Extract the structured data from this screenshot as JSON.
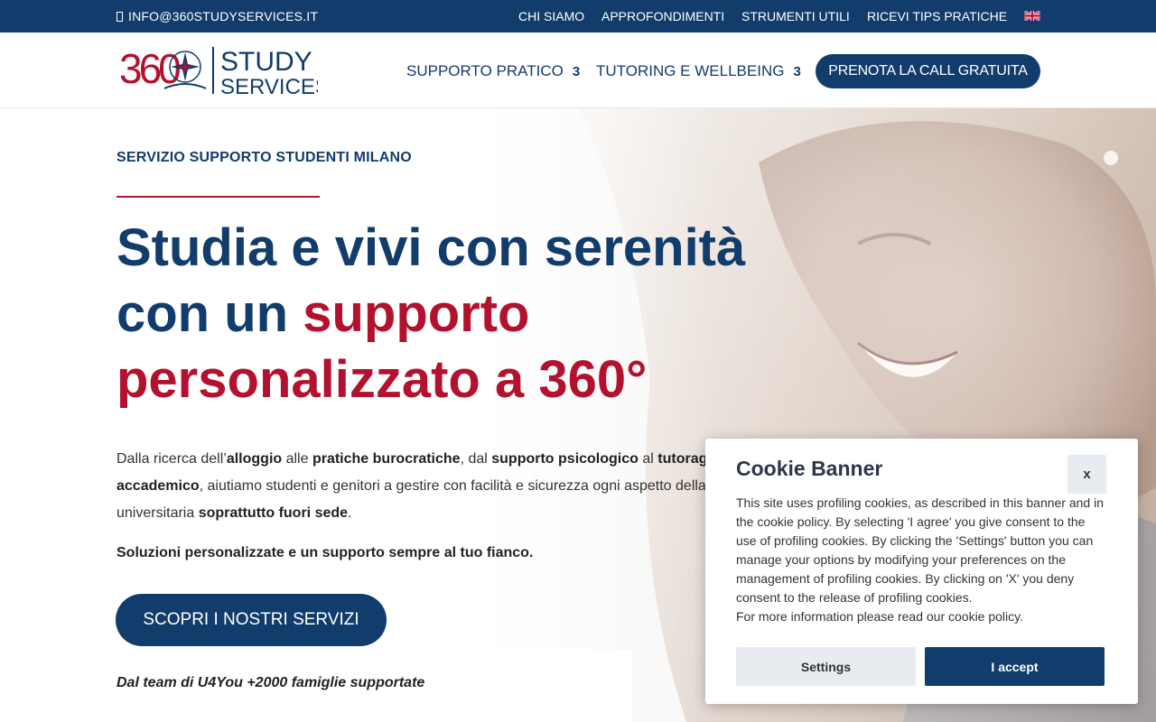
{
  "topbar": {
    "email": "INFO@360STUDYSERVICES.IT",
    "links": [
      "CHI SIAMO",
      "APPROFONDIMENTI",
      "STRUMENTI UTILI",
      "RICEVI TIPS PRATICHE"
    ]
  },
  "header": {
    "logo_number": "360",
    "logo_word1": "STUDY",
    "logo_word2": "SERVICES",
    "nav": [
      {
        "label": "SUPPORTO PRATICO",
        "count": "3"
      },
      {
        "label": "TUTORING E WELLBEING",
        "count": "3"
      }
    ],
    "cta": "PRENOTA LA CALL GRATUITA"
  },
  "hero": {
    "eyebrow": "SERVIZIO SUPPORTO STUDENTI MILANO",
    "headline_part1": "Studia e vivi con serenità con un ",
    "headline_part2": "supporto personalizzato a 360°",
    "desc": {
      "t1": "Dalla ricerca dell’",
      "b1": "alloggio",
      "t2": " alle ",
      "b2": "pratiche burocratiche",
      "t3": ", dal ",
      "b3": "supporto psicologico",
      "t4": " al ",
      "b4": "tutoraggio accademico",
      "t5": ", aiutiamo studenti e genitori a gestire con facilità e sicurezza ogni aspetto della vita universitaria ",
      "b5": "soprattutto fuori sede",
      "t6": "."
    },
    "tagline": "Soluzioni personalizzate e un supporto sempre al tuo fianco.",
    "cta": "SCOPRI I NOSTRI SERVIZI",
    "team": "Dal team di U4You +2000 famiglie supportate"
  },
  "cookie": {
    "title": "Cookie Banner",
    "close": "x",
    "body1": "This site uses profiling cookies, as described in this banner and in the cookie policy. By selecting 'I agree' you give consent to the use of profiling cookies. By clicking the 'Settings' button you can manage your options by modifying your preferences on the management of profiling cookies. By clicking on 'X' you deny consent to the release of profiling cookies.",
    "body2": "For more information please read our cookie policy.",
    "settings": "Settings",
    "accept": "I accept"
  },
  "colors": {
    "navy": "#123c6b",
    "red": "#b3122f"
  },
  "icons": [
    "mail-icon",
    "uk-flag-icon",
    "compass-rose-icon"
  ]
}
